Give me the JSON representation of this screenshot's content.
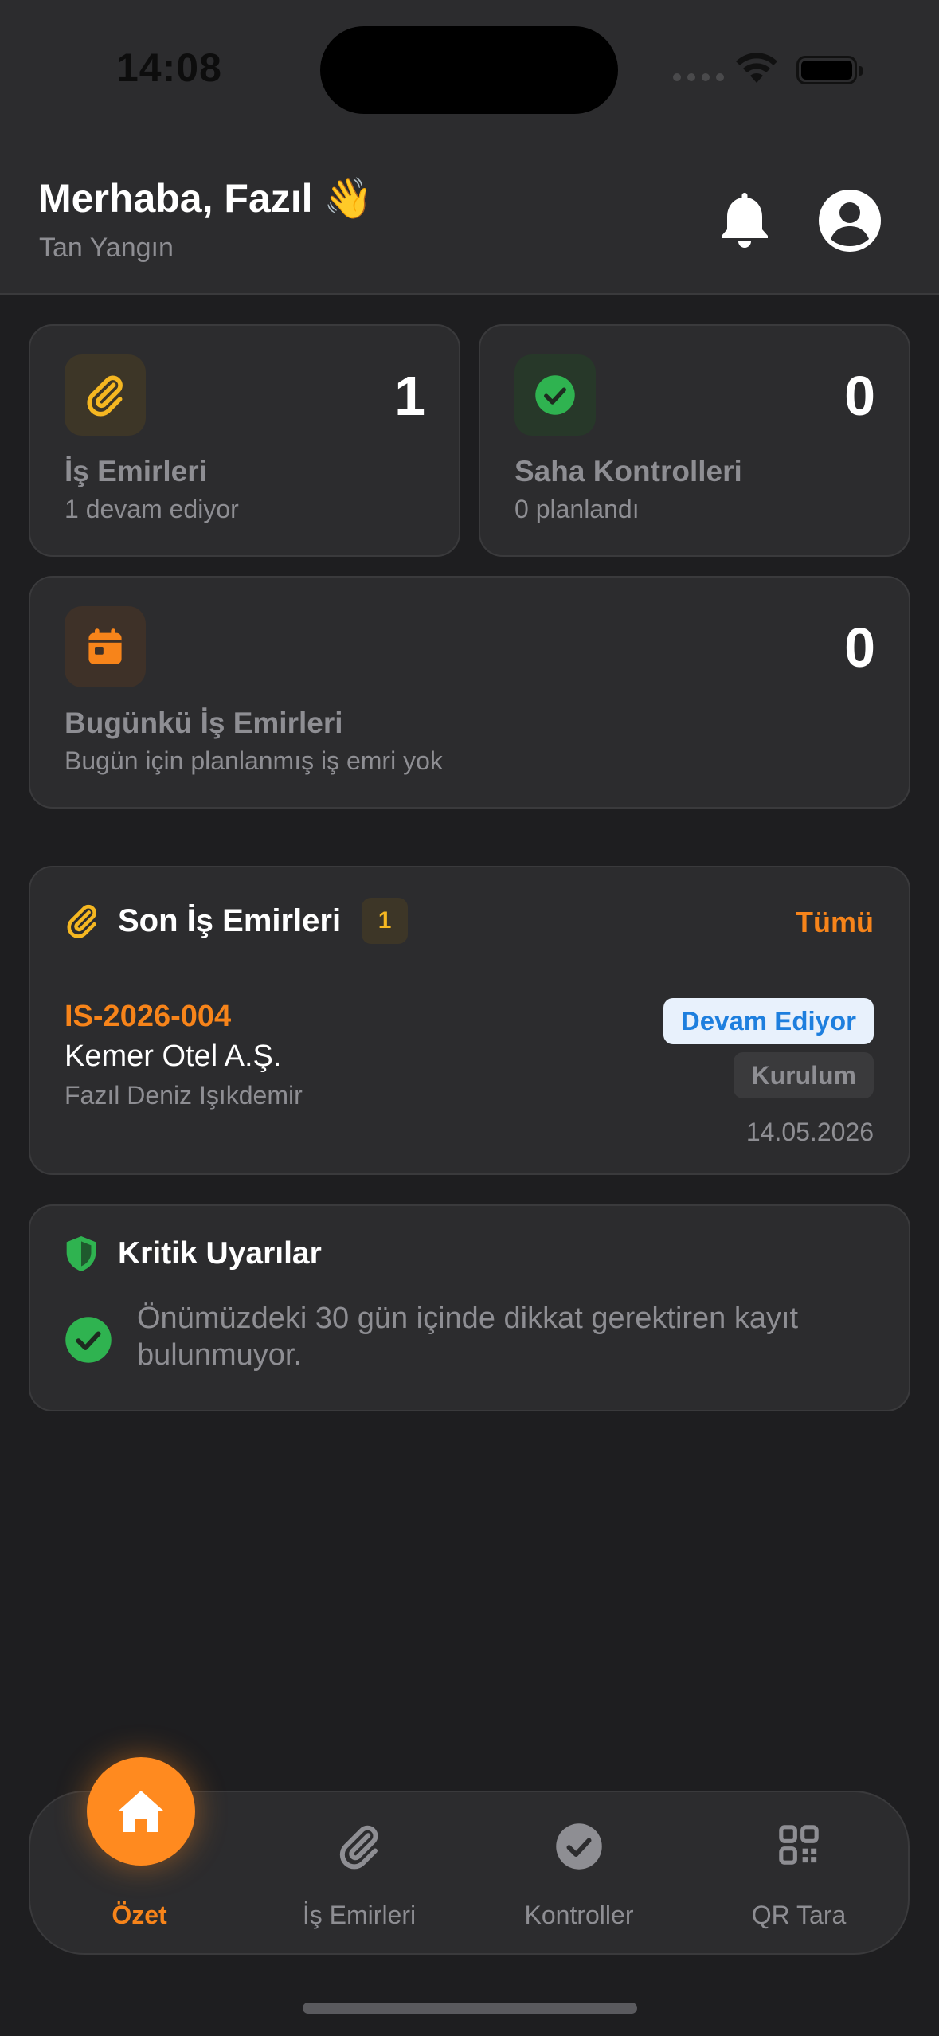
{
  "status_bar": {
    "time": "14:08"
  },
  "header": {
    "greeting": "Merhaba, Fazıl 👋",
    "company": "Tan Yangın",
    "icons": [
      "bell-icon",
      "profile-icon"
    ]
  },
  "stats": {
    "work_orders": {
      "value": "1",
      "title": "İş Emirleri",
      "subtitle": "1 devam ediyor",
      "icon": "paperclip-icon",
      "color": "#f5b721"
    },
    "field_checks": {
      "value": "0",
      "title": "Saha Kontrolleri",
      "subtitle": "0 planlandı",
      "icon": "check-circle-icon",
      "color": "#2fb350"
    },
    "today_orders": {
      "value": "0",
      "title": "Bugünkü İş Emirleri",
      "subtitle": "Bugün için planlanmış iş emri yok",
      "icon": "calendar-icon",
      "color": "#f7841a"
    }
  },
  "recent_orders": {
    "title": "Son İş Emirleri",
    "count": "1",
    "all_label": "Tümü",
    "items": [
      {
        "code": "IS-2026-004",
        "client": "Kemer Otel A.Ş.",
        "person": "Fazıl Deniz Işıkdemir",
        "status": "Devam Ediyor",
        "type": "Kurulum",
        "date": "14.05.2026"
      }
    ]
  },
  "critical_alerts": {
    "title": "Kritik Uyarılar",
    "message": "Önümüzdeki 30 gün içinde dikkat gerektiren kayıt bulunmuyor."
  },
  "tabbar": {
    "tabs": [
      {
        "label": "Özet",
        "icon": "home-icon",
        "active": true
      },
      {
        "label": "İş Emirleri",
        "icon": "paperclip-icon",
        "active": false
      },
      {
        "label": "Kontroller",
        "icon": "check-circle-icon",
        "active": false
      },
      {
        "label": "QR Tara",
        "icon": "qr-code-icon",
        "active": false
      }
    ]
  },
  "colors": {
    "accent": "#f7841a",
    "success": "#2fb350",
    "info": "#1e7fde",
    "background": "#1e1e20",
    "card": "#2c2c2e"
  }
}
